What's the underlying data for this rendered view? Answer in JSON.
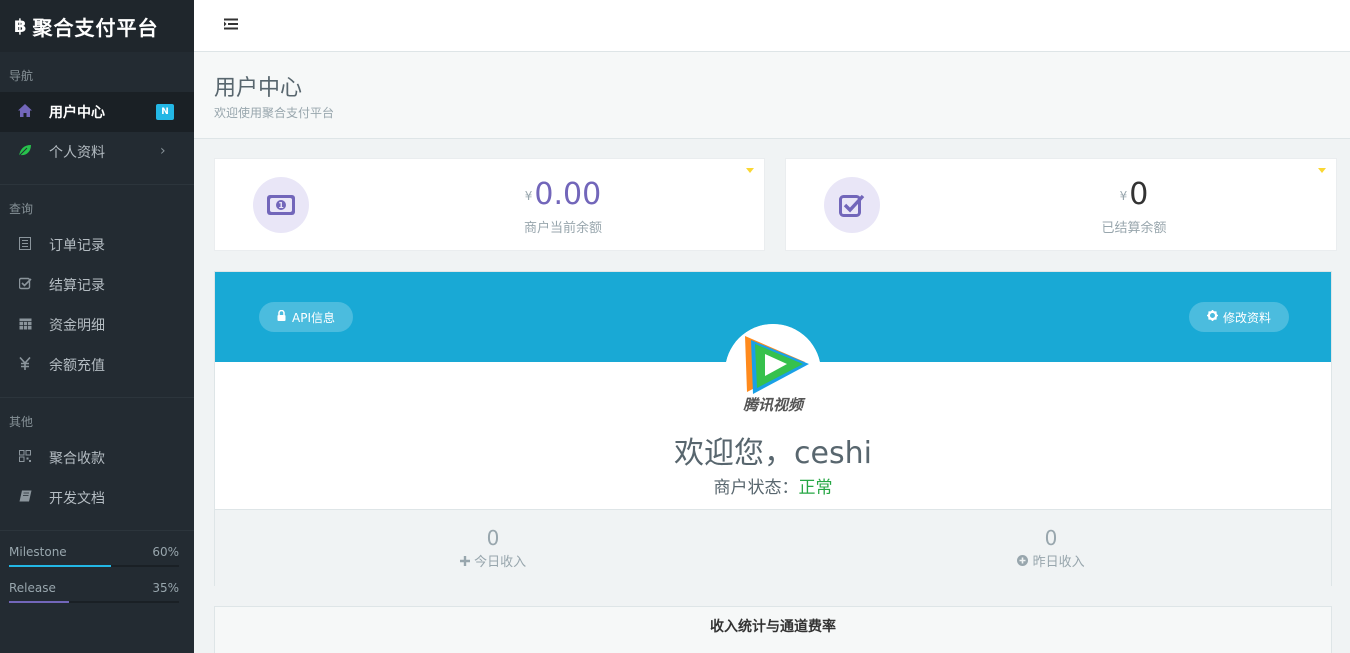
{
  "brand": {
    "icon": "฿",
    "name": "聚合支付平台"
  },
  "sidebar": {
    "sections": [
      {
        "title": "导航"
      },
      {
        "title": "查询"
      },
      {
        "title": "其他"
      }
    ],
    "items": [
      {
        "label": "用户中心",
        "icon": "home-icon",
        "badge": "N"
      },
      {
        "label": "个人资料",
        "icon": "leaf-icon",
        "chevron": "›"
      },
      {
        "label": "订单记录",
        "icon": "list-icon"
      },
      {
        "label": "结算记录",
        "icon": "check-square-icon"
      },
      {
        "label": "资金明细",
        "icon": "calendar-icon"
      },
      {
        "label": "余额充值",
        "icon": "yen-icon"
      },
      {
        "label": "聚合收款",
        "icon": "qrcode-icon"
      },
      {
        "label": "开发文档",
        "icon": "book-icon"
      }
    ],
    "progress": [
      {
        "label": "Milestone",
        "percent_text": "60%",
        "value": 0.6,
        "color": "#23b7e5"
      },
      {
        "label": "Release",
        "percent_text": "35%",
        "value": 0.35,
        "color": "#7266ba"
      }
    ]
  },
  "header": {
    "title": "用户中心",
    "subtitle": "欢迎使用聚合支付平台"
  },
  "stats": [
    {
      "currency": "¥",
      "value": "0.00",
      "label": "商户当前余额",
      "icon": "money-icon"
    },
    {
      "currency": "¥",
      "value": "0",
      "label": "已结算余额",
      "icon": "check-square-icon"
    }
  ],
  "profile": {
    "api_button": "API信息",
    "edit_button": "修改资料",
    "avatar_text": "腾讯视频",
    "welcome": "欢迎您，ceshi",
    "status_label": "商户状态：",
    "status_value": "正常",
    "today_value": "0",
    "today_label": "今日收入",
    "yesterday_value": "0",
    "yesterday_label": "昨日收入"
  },
  "bottom": {
    "title": "收入统计与通道费率"
  },
  "colors": {
    "accent": "#7266ba",
    "info": "#19a9d5",
    "success": "#27a745",
    "sidebar": "#232b32"
  }
}
